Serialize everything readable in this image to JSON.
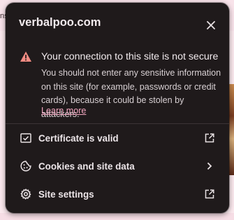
{
  "popup": {
    "site_title": "verbalpoo.com",
    "close_icon": "close-icon",
    "security": {
      "icon": "warning-triangle-icon",
      "title": "Your connection to this site is not secure",
      "body": "You should not enter any sensitive information on this site (for example, passwords or credit cards), because it could be stolen by attackers.",
      "learn_more": "Learn more"
    },
    "rows": [
      {
        "label": "Certificate is valid",
        "icon": "certificate-icon",
        "trail_icon": "open-external-icon"
      },
      {
        "label": "Cookies and site data",
        "icon": "cookie-icon",
        "trail_icon": "chevron-right-icon"
      },
      {
        "label": "Site settings",
        "icon": "gear-icon",
        "trail_icon": "open-external-icon"
      }
    ]
  },
  "background_page": {
    "fragment_text": "ns"
  },
  "colors": {
    "popup_bg": "#1f1a1b",
    "warning_red": "#f28b82",
    "link_pink": "#f3a7c0",
    "text_primary": "#f1eaed"
  }
}
